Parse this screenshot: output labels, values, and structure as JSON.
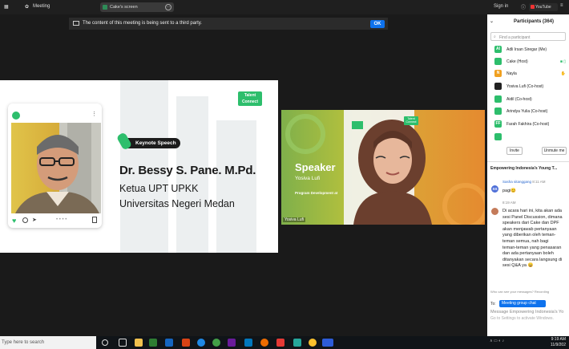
{
  "topbar": {
    "meeting": "Meeting",
    "share_label": "Cake's screen",
    "sign_in": "Sign in",
    "youtube": "YouTube"
  },
  "notice": {
    "text": "The content of this meeting is being sent to a third party.",
    "ok": "OK"
  },
  "slide": {
    "badge": "Talent Connect",
    "keynote": "Keynote Speech",
    "name": "Dr. Bessy S. Pane. M.Pd.",
    "title1": "Ketua UPT UPKK",
    "title2": "Universitas Negeri Medan"
  },
  "video": {
    "speaker": "Speaker",
    "speaker_name": "Yosiva Lufi",
    "program": "Program Development at",
    "badge": "Talent Connect",
    "tag": "Yosiva Lufi"
  },
  "participants": {
    "title": "Participants (364)",
    "search_placeholder": "Find a participant",
    "list": [
      {
        "initials": "AI",
        "name": "Adli Irsan Siregar (Me)",
        "color": "#2dbe6c"
      },
      {
        "initials": "",
        "name": "Cake (Host)",
        "color": "#2dbe6c"
      },
      {
        "initials": "N",
        "name": "Nayla",
        "color": "#f0a020"
      },
      {
        "initials": "",
        "name": "Yosiva Lufi (Co-host)",
        "color": "#222222"
      },
      {
        "initials": "",
        "name": "Aidil (Co-host)",
        "color": "#2dbe6c"
      },
      {
        "initials": "",
        "name": "Arindya Yulia (Co-host)",
        "color": "#2dbe6c"
      },
      {
        "initials": "FF",
        "name": "Farah Fakhira (Co-host)",
        "color": "#2dbe6c"
      },
      {
        "initials": "",
        "name": "",
        "color": "#2dbe6c"
      }
    ],
    "invite": "Invite",
    "unmute": "Unmute me"
  },
  "chat": {
    "title": "Empowering Indonesia's Young T...",
    "msg1": {
      "initials": "SS",
      "who": "Sasha sitanggang",
      "time": "8:11 AM",
      "body": "pagi😊"
    },
    "msg2": {
      "who": "",
      "time": "8:19 AM",
      "lines": [
        "Di acara hari ini, kita akan ada",
        "sesi Panel Discussion, dimana",
        "speakers dari Cake dan DPF",
        "akan menjawab pertanyaan",
        "yang diberikan oleh teman-",
        "teman semua, nah bagi",
        "teman-teman yang penasaran",
        "dan ada pertanyaan boleh",
        "ditanyakan secara langsung di",
        "sesi Q&A ya 😀"
      ]
    },
    "who_see": "Who can see your messages? Recording",
    "to": "To:",
    "to_target": "Meeting group chat",
    "input_placeholder": "Message Empowering Indonesia's Yo",
    "watermark": "Go to Settings to activate Windows."
  },
  "taskbar": {
    "search": "Type here to search",
    "time": "9:19 AM",
    "date": "11/9/202"
  }
}
